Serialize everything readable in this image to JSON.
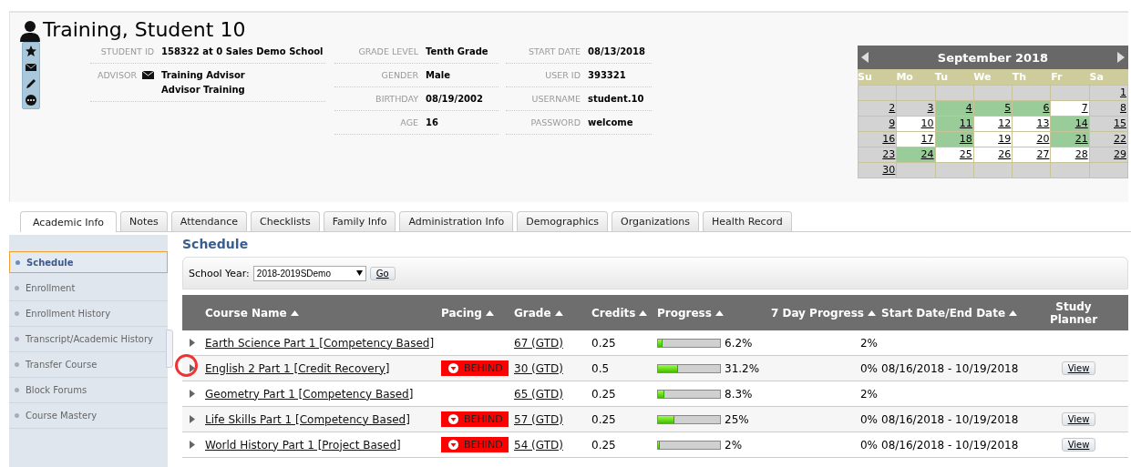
{
  "student": {
    "name": "Training, Student 10"
  },
  "info_columns": [
    [
      {
        "label": "STUDENT ID",
        "value": "158322 at 0 Sales Demo School"
      },
      {
        "label": "ADVISOR",
        "kind": "advisor",
        "value": "Training Advisor",
        "value_2": "Advisor Training"
      }
    ],
    [
      {
        "label": "GRADE LEVEL",
        "value": "Tenth Grade"
      },
      {
        "label": "GENDER",
        "value": "Male"
      },
      {
        "label": "BIRTHDAY",
        "value": "08/19/2002"
      },
      {
        "label": "AGE",
        "value": "16"
      }
    ],
    [
      {
        "label": "START DATE",
        "value": "08/13/2018"
      },
      {
        "label": "USER ID",
        "value": "393321"
      },
      {
        "label": "USERNAME",
        "value": "student.10"
      },
      {
        "label": "PASSWORD",
        "value": "welcome"
      }
    ]
  ],
  "calendar": {
    "title": "September 2018",
    "weekdays": [
      "Su",
      "Mo",
      "Tu",
      "We",
      "Th",
      "Fr",
      "Sa"
    ],
    "weeks": [
      [
        {
          "color": "#d3d3d3"
        },
        {
          "color": "#d3d3d3"
        },
        {
          "color": "#d3d3d3"
        },
        {
          "color": "#d3d3d3"
        },
        {
          "color": "#d3d3d3"
        },
        {
          "color": "#d3d3d3"
        },
        {
          "day": "1",
          "color": "#d3d3d3"
        }
      ],
      [
        {
          "day": "2",
          "color": "#d3d3d3"
        },
        {
          "day": "3",
          "color": "#d3d3d3"
        },
        {
          "day": "4",
          "color": "#99cc99"
        },
        {
          "day": "5",
          "color": "#99cc99"
        },
        {
          "day": "6",
          "color": "#99cc99"
        },
        {
          "day": "7",
          "color": "#ffffff"
        },
        {
          "day": "8",
          "color": "#d3d3d3"
        }
      ],
      [
        {
          "day": "9",
          "color": "#d3d3d3"
        },
        {
          "day": "10",
          "color": "#ffffff"
        },
        {
          "day": "11",
          "color": "#99cc99"
        },
        {
          "day": "12",
          "color": "#ffffff"
        },
        {
          "day": "13",
          "color": "#ffffff"
        },
        {
          "day": "14",
          "color": "#99cc99"
        },
        {
          "day": "15",
          "color": "#d3d3d3"
        }
      ],
      [
        {
          "day": "16",
          "color": "#d3d3d3"
        },
        {
          "day": "17",
          "color": "#ffffff"
        },
        {
          "day": "18",
          "color": "#99cc99"
        },
        {
          "day": "19",
          "color": "#ffffff"
        },
        {
          "day": "20",
          "color": "#ffffff"
        },
        {
          "day": "21",
          "color": "#99cc99"
        },
        {
          "day": "22",
          "color": "#d3d3d3"
        }
      ],
      [
        {
          "day": "23",
          "color": "#d3d3d3"
        },
        {
          "day": "24",
          "color": "#99cc99"
        },
        {
          "day": "25",
          "color": "#ffffff"
        },
        {
          "day": "26",
          "color": "#ffffff"
        },
        {
          "day": "27",
          "color": "#ffffff"
        },
        {
          "day": "28",
          "color": "#ffffff"
        },
        {
          "day": "29",
          "color": "#d3d3d3"
        }
      ],
      [
        {
          "day": "30",
          "color": "#d3d3d3"
        },
        {
          "color": "#d3d3d3"
        },
        {
          "color": "#d3d3d3"
        },
        {
          "color": "#d3d3d3"
        },
        {
          "color": "#d3d3d3"
        },
        {
          "color": "#d3d3d3"
        },
        {
          "color": "#d3d3d3"
        }
      ]
    ]
  },
  "tabs": [
    {
      "label": "Academic Info",
      "selected": true
    },
    {
      "label": "Notes",
      "selected": false
    },
    {
      "label": "Attendance",
      "selected": false
    },
    {
      "label": "Checklists",
      "selected": false
    },
    {
      "label": "Family Info",
      "selected": false
    },
    {
      "label": "Administration Info",
      "selected": false
    },
    {
      "label": "Demographics",
      "selected": false
    },
    {
      "label": "Organizations",
      "selected": false
    },
    {
      "label": "Health Record",
      "selected": false
    }
  ],
  "sidebar": {
    "items": [
      {
        "label": "Schedule",
        "selected": true
      },
      {
        "label": "Enrollment",
        "selected": false
      },
      {
        "label": "Enrollment History",
        "selected": false
      },
      {
        "label": "Transcript/Academic History",
        "selected": false
      },
      {
        "label": "Transfer Course",
        "selected": false
      },
      {
        "label": "Block Forums",
        "selected": false
      },
      {
        "label": "Course Mastery",
        "selected": false
      }
    ]
  },
  "schedule": {
    "title": "Schedule",
    "school_year_label": "School Year:",
    "school_year": "2018-2019SDemo",
    "go_button": "Go",
    "columns": [
      "Course Name",
      "Pacing",
      "Grade",
      "Credits",
      "Progress",
      "7 Day Progress",
      "Start Date/End Date",
      "Study Planner"
    ],
    "rows": [
      {
        "course": "Earth Science Part 1 [Competency Based]",
        "behind": false,
        "grade": "67 (GTD)",
        "credits": "0.25",
        "level": 0.062,
        "progress": "6.2%",
        "seven_day": "2%",
        "highlighted": false
      },
      {
        "course": "English 2 Part 1 [Credit Recovery]",
        "behind": true,
        "pacing": "BEHIND",
        "grade": "30 (GTD)",
        "credits": "0.5",
        "level": 0.312,
        "progress": "31.2%",
        "seven_day": "0%",
        "dates": "08/16/2018 - 10/19/2018",
        "planner": "View",
        "highlighted": true
      },
      {
        "course": "Geometry Part 1 [Competency Based]",
        "behind": false,
        "grade": "65 (GTD)",
        "credits": "0.25",
        "level": 0.083,
        "progress": "8.3%",
        "seven_day": "2%",
        "highlighted": false
      },
      {
        "course": "Life Skills Part 1 [Competency Based]",
        "behind": true,
        "pacing": "BEHIND",
        "grade": "57 (GTD)",
        "credits": "0.25",
        "level": 0.25,
        "progress": "25%",
        "seven_day": "0%",
        "dates": "08/16/2018 - 10/19/2018",
        "planner": "View",
        "highlighted": false
      },
      {
        "course": "World History Part 1 [Project Based]",
        "behind": true,
        "pacing": "BEHIND",
        "grade": "54 (GTD)",
        "credits": "0.25",
        "level": 0.02,
        "progress": "2%",
        "seven_day": "0%",
        "dates": "08/16/2018 - 10/19/2018",
        "planner": "View",
        "highlighted": false
      }
    ]
  }
}
